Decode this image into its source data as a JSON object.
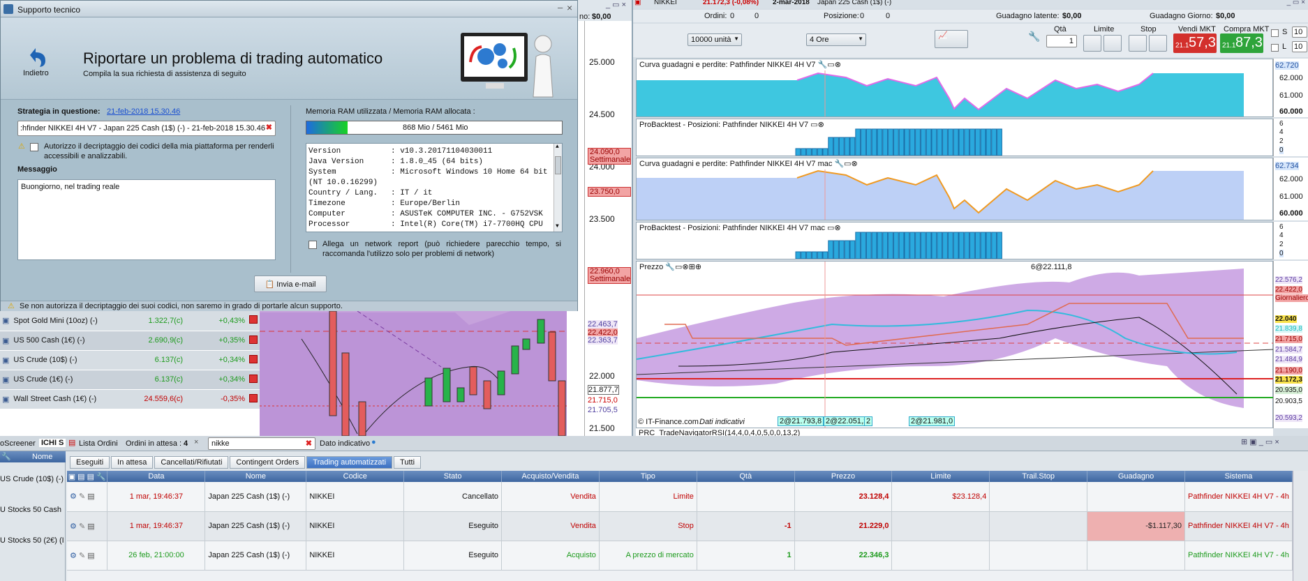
{
  "top_bar": {
    "nikkei_title": "NIKKEI",
    "nikkei_quote": "21.172,3 (-0,08%)",
    "nikkei_date": "2-mar-2018",
    "nikkei_instrument": "Japan 225 Cash (1$) (-)",
    "left_label": "no:",
    "left_value": "$0,00",
    "orders_label": "Ordini:",
    "orders_count": "0",
    "orders_count2": "0",
    "position_label": "Posizione:",
    "position_count": "0",
    "position_count2": "0",
    "latent_label": "Guadagno latente:",
    "latent_value": "$0,00",
    "day_label": "Guadagno Giorno:",
    "day_value": "$0,00"
  },
  "toolbar": {
    "units": "10000 unità",
    "timeframe": "4 Ore",
    "qty_label": "Qtà",
    "qty_value": "1",
    "limit_label": "Limite",
    "stop_label": "Stop",
    "sell_label": "Vendi MKT",
    "sell_small": "21.1",
    "sell_big": "57,3",
    "buy_label": "Compra MKT",
    "buy_small": "21.1",
    "buy_big": "87,3",
    "s_label": "S",
    "l_label": "L",
    "s_value": "10",
    "l_value": "10"
  },
  "dialog": {
    "title": "Supporto tecnico",
    "back_label": "Indietro",
    "heading": "Riportare un problema di trading automatico",
    "subheading": "Compila la sua richiesta di assistenza di seguito",
    "strategy_label": "Strategia in questione:",
    "strategy_link": "21-feb-2018 15.30.46",
    "strategy_field": ":hfinder NIKKEI 4H V7 - Japan 225 Cash (1$) (-) - 21-feb-2018 15.30.46",
    "authorize_text": "Autorizzo il decriptaggio dei codici della mia piattaforma per renderli accessibili e analizzabili.",
    "message_label": "Messaggio",
    "message_text": "Buongiorno, nel trading reale",
    "ram_label": "Memoria RAM utilizzata / Memoria RAM allocata :",
    "ram_text": "868 Mio / 5461 Mio",
    "ram_fraction": 0.16,
    "sysinfo": [
      {
        "k": "Version",
        "v": ": v10.3.20171104030011"
      },
      {
        "k": "Java Version",
        "v": ": 1.8.0_45 (64 bits)"
      },
      {
        "k": "System",
        "v": ": Microsoft Windows 10 Home 64 bit"
      },
      {
        "k": "(NT 10.0.16299)",
        "v": ""
      },
      {
        "k": "Country / Lang.",
        "v": ": IT / it"
      },
      {
        "k": "Timezone",
        "v": ": Europe/Berlin"
      },
      {
        "k": "Computer",
        "v": ": ASUSTeK COMPUTER INC. - G752VSK"
      },
      {
        "k": "Processor",
        "v": ": Intel(R) Core(TM) i7-7700HQ CPU"
      }
    ],
    "network_text": "Allega un network report (può richiedere parecchio tempo, si raccomanda l'utilizzo solo per problemi di network)",
    "send_button": "Invia e-mail",
    "warning": "Se non autorizza il decriptaggio dei suoi codici, non saremo in grado di portarle alcun supporto."
  },
  "left_chart": {
    "axis_labels": [
      "25.000",
      "24.500",
      "24.000",
      "23.500",
      "22.000",
      "21.500"
    ],
    "tag_weekly1_price": "24.090,0",
    "tag_weekly1_label": "Settimanale",
    "tag_red2": "23.750,0",
    "tag_weekly2_price": "22.960,0",
    "tag_weekly2_label": "Settimanale",
    "tags_small": [
      "22.463,7",
      "22.422,0",
      "22.363,7",
      "21.877,7",
      "21.715,0",
      "21.705,5"
    ]
  },
  "watchlist": [
    {
      "name": "Spot Gold Mini (10oz) (-)",
      "price": "1.322,7(c)",
      "change": "+0,43%"
    },
    {
      "name": "US 500 Cash (1€) (-)",
      "price": "2.690,9(c)",
      "change": "+0,35%"
    },
    {
      "name": "US Crude (10$) (-)",
      "price": "6.137(c)",
      "change": "+0,34%"
    },
    {
      "name": "US Crude (1€) (-)",
      "price": "6.137(c)",
      "change": "+0,34%"
    },
    {
      "name": "Wall Street Cash (1€) (-)",
      "price": "24.559,6(c)",
      "change": "-0,35%"
    }
  ],
  "panels": {
    "p1_title": "Curva guadagni e perdite: Pathfinder NIKKEI 4H V7",
    "p1_axis": [
      "62.720",
      "62.000",
      "61.000",
      "60.000"
    ],
    "p2_title": "ProBacktest - Posizioni: Pathfinder NIKKEI 4H V7",
    "p2_axis": [
      "6",
      "4",
      "2",
      "0"
    ],
    "p3_title": "Curva guadagni e perdite: Pathfinder NIKKEI 4H V7 mac",
    "p3_axis": [
      "62.734",
      "62.000",
      "61.000",
      "60.000"
    ],
    "p4_title": "ProBacktest - Posizioni: Pathfinder NIKKEI 4H V7 mac",
    "p4_axis": [
      "6",
      "4",
      "2",
      "0"
    ],
    "price_title": "Prezzo",
    "price_annot": "6@22.111,8",
    "price_copyright": "© IT-Finance.com",
    "price_indicative": "Dati indicativi",
    "price_trades": [
      "2@21.793,8",
      "2@22.051,2",
      "2",
      "2@21.981,0"
    ],
    "price_axis": [
      "22.576,2",
      "22.422,0",
      "Giornaliero",
      "22.040",
      "21.839,8",
      "21.715,0",
      "21.584,7",
      "21.484,9",
      "21.190,0",
      "21.172,3",
      "20.935,0",
      "20.903,5",
      "20.593,2"
    ],
    "next_panel": "PRC_TradeNavigatorRSI(14,4,0,4,0,5,0,0,13,2)"
  },
  "bottom": {
    "screener_tab": "oScreener",
    "ichi_tab": "ICHI S",
    "orders_list_tab": "Lista Ordini",
    "pending_label": "Ordini in attesa :",
    "pending_count": "4",
    "search_value": "nikke",
    "indicative": "Dato indicativo",
    "left_header": "Nome",
    "left_items": [
      "US Crude (10$) (-)",
      "U Stocks 50 Cash",
      "U Stocks 50 (2€) (I"
    ],
    "tabs": [
      "Eseguiti",
      "In attesa",
      "Cancellati/Rifiutati",
      "Contingent Orders",
      "Trading automatizzati",
      "Tutti"
    ],
    "columns": [
      "Data",
      "Nome",
      "Codice",
      "Stato",
      "Acquisto/Vendita",
      "Tipo",
      "Qtà",
      "Prezzo",
      "Limite",
      "Trail.Stop",
      "Guadagno",
      "Sistema"
    ],
    "rows": [
      {
        "data": "1 mar, 19:46:37",
        "nome": "Japan 225 Cash (1$) (-)",
        "codice": "NIKKEI",
        "stato": "Cancellato",
        "av": "Vendita",
        "tipo": "Limite",
        "qta": "",
        "prezzo": "23.128,4",
        "limite": "$23.128,4",
        "trail": "",
        "guadagno": "",
        "sistema": "Pathfinder NIKKEI 4H V7 - 4h"
      },
      {
        "data": "1 mar, 19:46:37",
        "nome": "Japan 225 Cash (1$) (-)",
        "codice": "NIKKEI",
        "stato": "Eseguito",
        "av": "Vendita",
        "tipo": "Stop",
        "qta": "-1",
        "prezzo": "21.229,0",
        "limite": "",
        "trail": "",
        "guadagno": "-$1.117,30",
        "sistema": "Pathfinder NIKKEI 4H V7 - 4h"
      },
      {
        "data": "26 feb, 21:00:00",
        "nome": "Japan 225 Cash (1$) (-)",
        "codice": "NIKKEI",
        "stato": "Eseguito",
        "av": "Acquisto",
        "tipo": "A prezzo di mercato",
        "qta": "1",
        "prezzo": "22.346,3",
        "limite": "",
        "trail": "",
        "guadagno": "",
        "sistema": "Pathfinder NIKKEI 4H V7 - 4h"
      }
    ]
  }
}
